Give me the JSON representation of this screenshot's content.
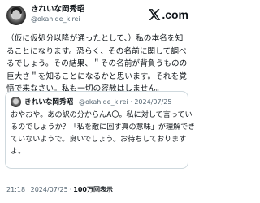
{
  "author": {
    "display_name": "きれいな岡秀昭",
    "handle": "@okahide_kirei"
  },
  "brand": {
    "logo_text": ".com",
    "logo_icon": "x-logo-icon"
  },
  "post": {
    "lines": [
      "（仮に仮処分以降が通ったとして、）私の本名を知",
      "ることになります。恐らく、その名前に関して調べ",
      "るでしょう。その結果、＂その名前が背負うものの",
      "巨大さ＂を知ることになるかと思います。それを覚",
      "悟で来なさい。私も一切の容赦はしません。"
    ]
  },
  "quote": {
    "display_name": "きれいな岡秀昭",
    "handle": "@okahide_kirei",
    "separator": "·",
    "date": "2024/07/25",
    "lines": [
      "おやおや。あの訳の分からんA〇。私に対して言ってい",
      "るのでしょうか？「私を敵に回す真の意味」が理解でき",
      "ていないようで。良いでしょう。お待ちしております",
      "よ。"
    ]
  },
  "footer": {
    "time": "21:18",
    "sep1": "·",
    "date": "2024/07/25",
    "sep2": "·",
    "views": "100万回表示"
  }
}
